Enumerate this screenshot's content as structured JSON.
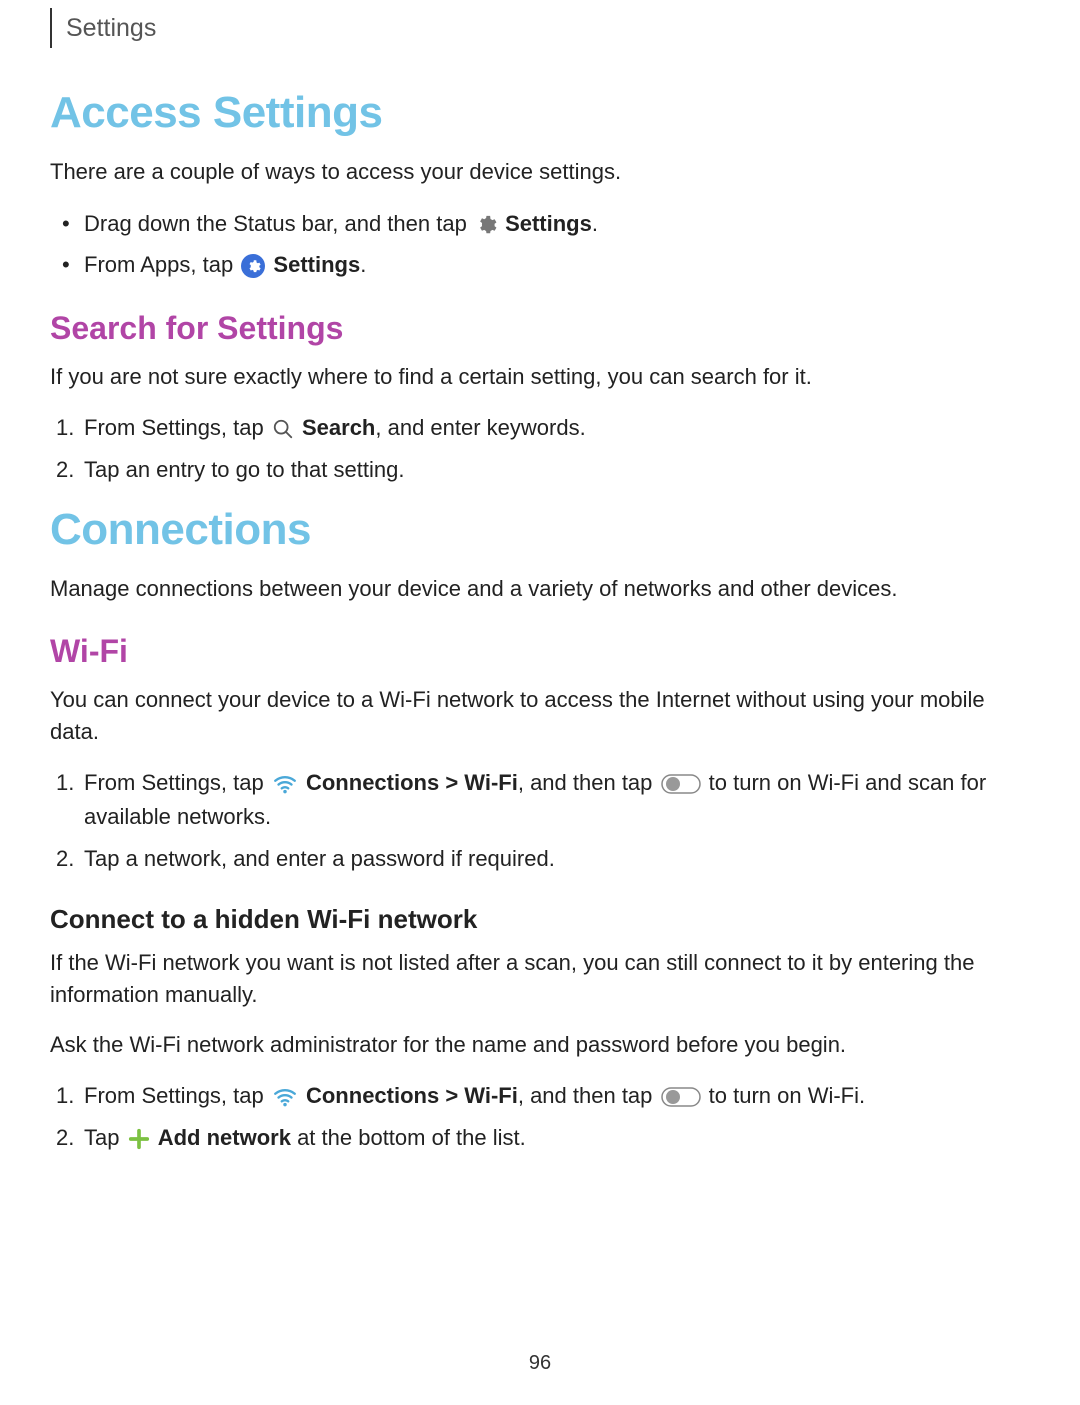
{
  "header": {
    "section_title": "Settings"
  },
  "section1": {
    "heading": "Access Settings",
    "intro": "There are a couple of ways to access your device settings.",
    "bullets": [
      {
        "pre": "Drag down the Status bar, and then tap ",
        "bold": "Settings",
        "post": "."
      },
      {
        "pre": "From Apps, tap ",
        "bold": "Settings",
        "post": "."
      }
    ],
    "sub1": {
      "heading": "Search for Settings",
      "intro": "If you are not sure exactly where to find a certain setting, you can search for it.",
      "steps": [
        {
          "pre": "From Settings, tap ",
          "bold": "Search",
          "post": ", and enter keywords."
        },
        {
          "text": "Tap an entry to go to that setting."
        }
      ]
    }
  },
  "section2": {
    "heading": "Connections",
    "intro": "Manage connections between your device and a variety of networks and other devices.",
    "wifi": {
      "heading": "Wi-Fi",
      "intro": "You can connect your device to a Wi-Fi network to access the Internet without using your mobile data.",
      "steps": [
        {
          "pre": "From Settings, tap ",
          "bold": "Connections > Wi-Fi",
          "mid": ", and then tap ",
          "post": " to turn on Wi-Fi and scan for available networks."
        },
        {
          "text": "Tap a network, and enter a password if required."
        }
      ],
      "hidden": {
        "heading": "Connect to a hidden Wi-Fi network",
        "intro": "If the Wi-Fi network you want is not listed after a scan, you can still connect to it by entering the information manually.",
        "note": "Ask the Wi-Fi network administrator for the name and password before you begin.",
        "steps": [
          {
            "pre": "From Settings, tap ",
            "bold": "Connections > Wi-Fi",
            "mid": ", and then tap ",
            "post": " to turn on Wi-Fi."
          },
          {
            "pre": "Tap ",
            "bold": "Add network",
            "post": " at the bottom of the list."
          }
        ]
      }
    }
  },
  "page_number": "96"
}
